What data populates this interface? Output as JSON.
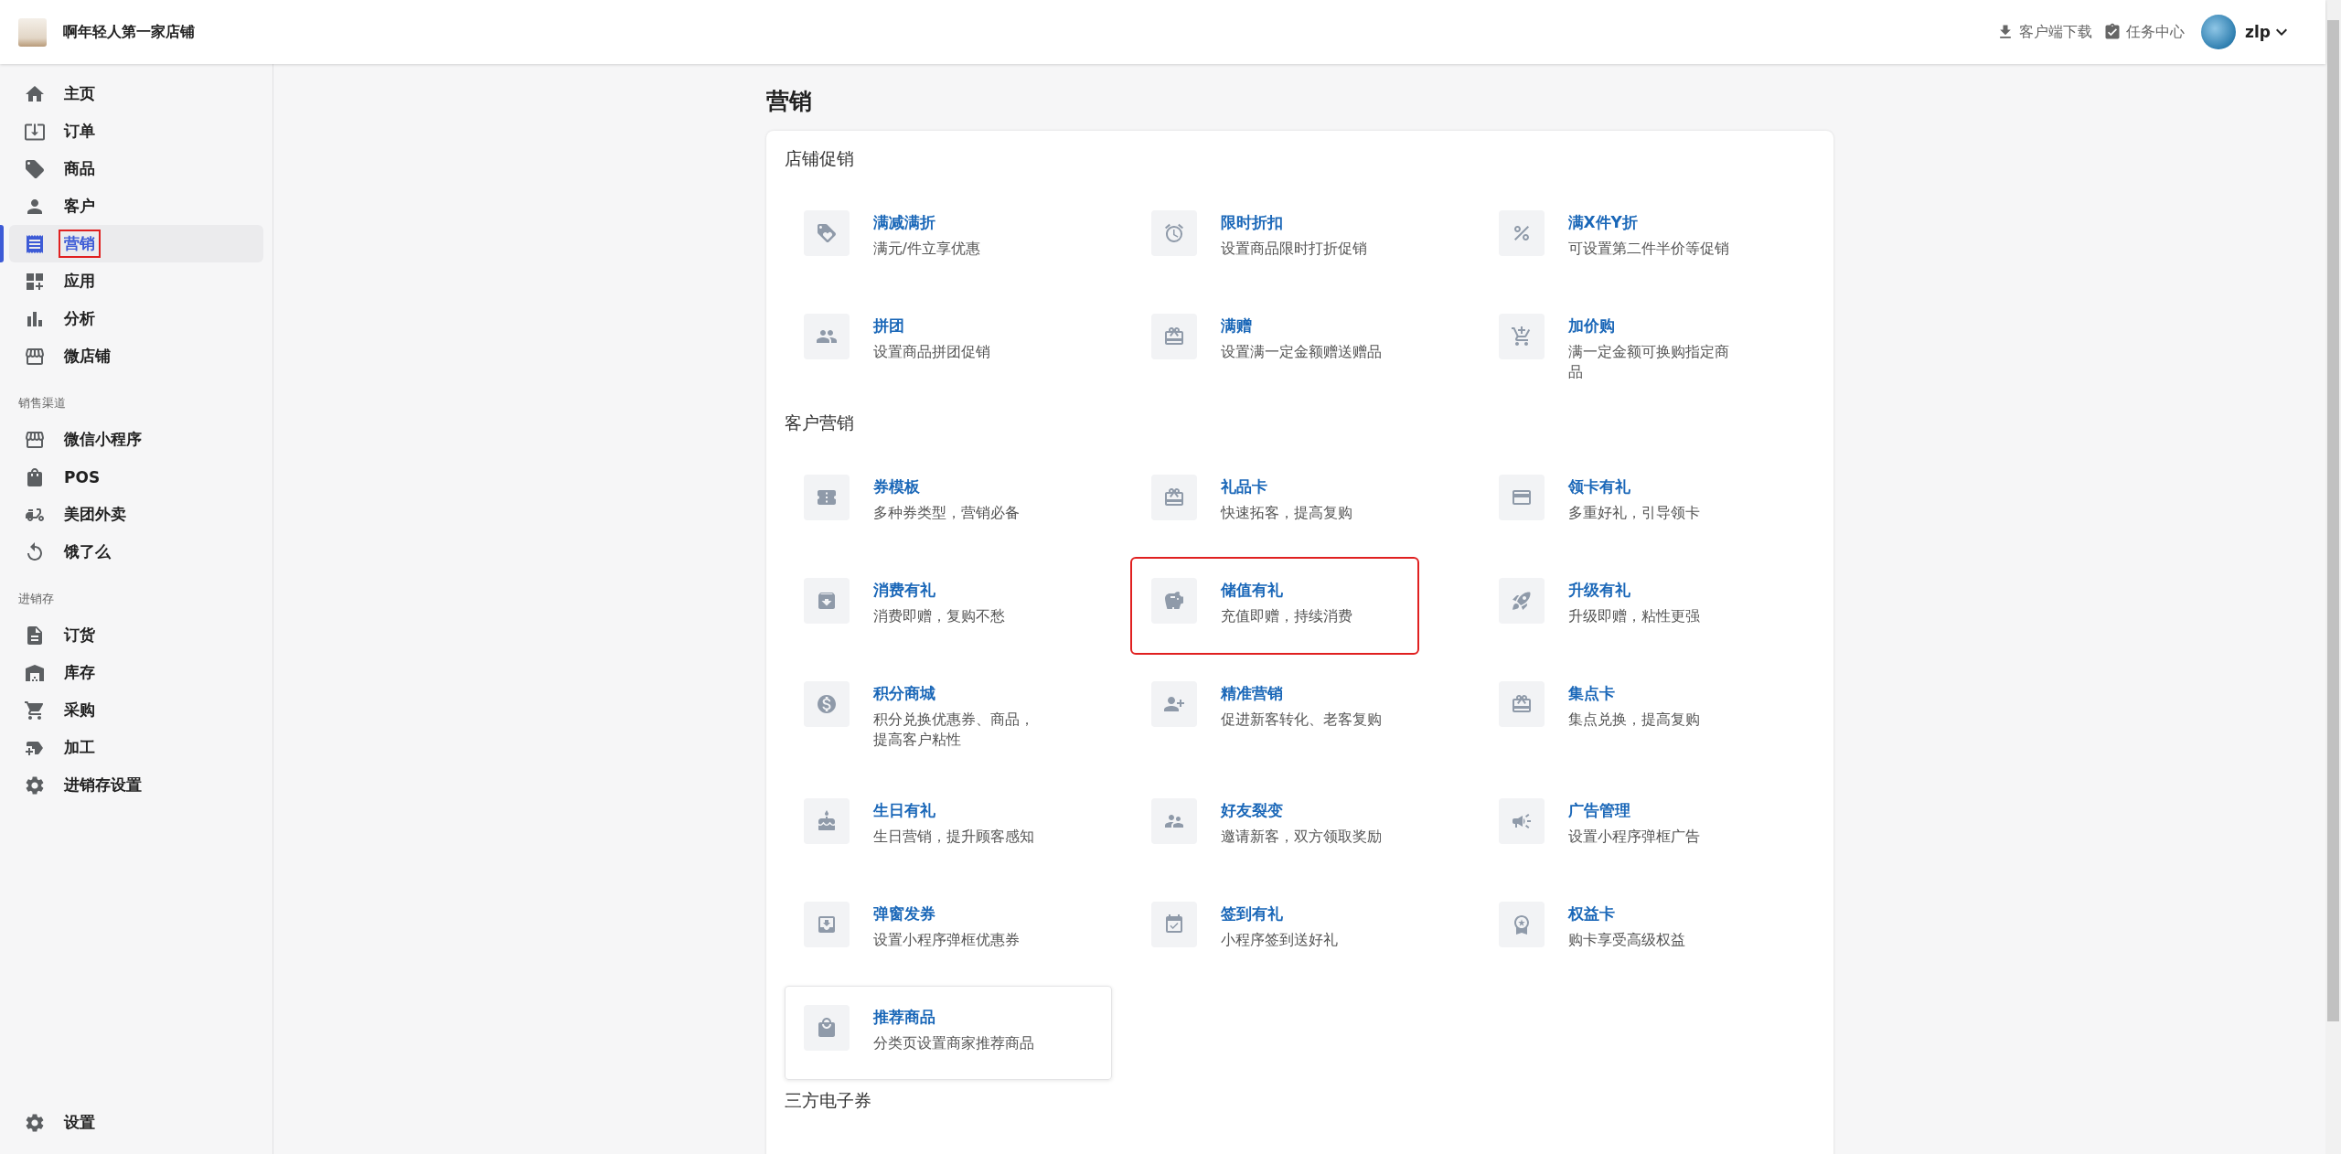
{
  "store": {
    "name": "啊年轻人第一家店铺"
  },
  "header": {
    "actions": [
      {
        "kind": "download",
        "label": "客户端下载"
      },
      {
        "kind": "tasks",
        "label": "任务中心"
      }
    ],
    "user": {
      "name": "zlp"
    }
  },
  "sidebar": {
    "groups": [
      {
        "items": [
          {
            "kind": "home",
            "label": "主页",
            "selected": false,
            "highlighted": false
          },
          {
            "kind": "orders",
            "label": "订单",
            "selected": false,
            "highlighted": false
          },
          {
            "kind": "tag",
            "label": "商品",
            "selected": false,
            "highlighted": false
          },
          {
            "kind": "person",
            "label": "客户",
            "selected": false,
            "highlighted": false
          },
          {
            "kind": "receipt",
            "label": "营销",
            "selected": true,
            "highlighted": true
          },
          {
            "kind": "apps",
            "label": "应用",
            "selected": false,
            "highlighted": false
          },
          {
            "kind": "chart",
            "label": "分析",
            "selected": false,
            "highlighted": false
          },
          {
            "kind": "store",
            "label": "微店铺",
            "selected": false,
            "highlighted": false
          }
        ]
      },
      {
        "heading": "销售渠道",
        "items": [
          {
            "kind": "store",
            "label": "微信小程序",
            "selected": false,
            "highlighted": false
          },
          {
            "kind": "bag",
            "label": "POS",
            "selected": false,
            "highlighted": false
          },
          {
            "kind": "delivery",
            "label": "美团外卖",
            "selected": false,
            "highlighted": false
          },
          {
            "kind": "eleme",
            "label": "饿了么",
            "selected": false,
            "highlighted": false
          }
        ]
      },
      {
        "heading": "进销存",
        "items": [
          {
            "kind": "doc",
            "label": "订货",
            "selected": false,
            "highlighted": false
          },
          {
            "kind": "warehouse",
            "label": "库存",
            "selected": false,
            "highlighted": false
          },
          {
            "kind": "cart",
            "label": "采购",
            "selected": false,
            "highlighted": false
          },
          {
            "kind": "newtag",
            "label": "加工",
            "selected": false,
            "highlighted": false
          },
          {
            "kind": "gear",
            "label": "进销存设置",
            "selected": false,
            "highlighted": false
          }
        ]
      }
    ],
    "footer": [
      {
        "kind": "gear",
        "label": "设置",
        "selected": false,
        "highlighted": false
      }
    ]
  },
  "page": {
    "title": "营销",
    "sections": [
      {
        "heading": "店铺促销",
        "tiles": [
          {
            "kind": "tags",
            "title": "满减满折",
            "description": "满元/件立享优惠",
            "highlighted": false,
            "hovered": false
          },
          {
            "kind": "timer",
            "title": "限时折扣",
            "description": "设置商品限时打折促销",
            "highlighted": false,
            "hovered": false
          },
          {
            "kind": "percent",
            "title": "满X件Y折",
            "description": "可设置第二件半价等促销",
            "highlighted": false,
            "hovered": false
          },
          {
            "kind": "people",
            "title": "拼团",
            "description": "设置商品拼团促销",
            "highlighted": false,
            "hovered": false
          },
          {
            "kind": "giftbadge",
            "title": "满赠",
            "description": "设置满一定金额赠送赠品",
            "highlighted": false,
            "hovered": false
          },
          {
            "kind": "cart",
            "title": "加价购",
            "description": "满一定金额可换购指定商品",
            "highlighted": false,
            "hovered": false
          }
        ]
      },
      {
        "heading": "客户营销",
        "tiles": [
          {
            "kind": "ticket",
            "title": "券模板",
            "description": "多种券类型，营销必备",
            "highlighted": false,
            "hovered": false
          },
          {
            "kind": "giftcard",
            "title": "礼品卡",
            "description": "快速拓客，提高复购",
            "highlighted": false,
            "hovered": false
          },
          {
            "kind": "card",
            "title": "领卡有礼",
            "description": "多重好礼，引导领卡",
            "highlighted": false,
            "hovered": false
          },
          {
            "kind": "archive",
            "title": "消费有礼",
            "description": "消费即赠，复购不愁",
            "highlighted": false,
            "hovered": false
          },
          {
            "kind": "moneybag",
            "title": "储值有礼",
            "description": "充值即赠，持续消费",
            "highlighted": true,
            "hovered": false
          },
          {
            "kind": "rocket",
            "title": "升级有礼",
            "description": "升级即赠，粘性更强",
            "highlighted": false,
            "hovered": false
          },
          {
            "kind": "coin",
            "title": "积分商城",
            "description": "积分兑换优惠券、商品，提高客户粘性",
            "highlighted": false,
            "hovered": false
          },
          {
            "kind": "personadd",
            "title": "精准营销",
            "description": "促进新客转化、老客复购",
            "highlighted": false,
            "hovered": false
          },
          {
            "kind": "gift",
            "title": "集点卡",
            "description": "集点兑换，提高复购",
            "highlighted": false,
            "hovered": false
          },
          {
            "kind": "cake",
            "title": "生日有礼",
            "description": "生日营销，提升顾客感知",
            "highlighted": false,
            "hovered": false
          },
          {
            "kind": "friends",
            "title": "好友裂变",
            "description": "邀请新客，双方领取奖励",
            "highlighted": false,
            "hovered": false
          },
          {
            "kind": "ad",
            "title": "广告管理",
            "description": "设置小程序弹框广告",
            "highlighted": false,
            "hovered": false
          },
          {
            "kind": "inbox",
            "title": "弹窗发券",
            "description": "设置小程序弹框优惠券",
            "highlighted": false,
            "hovered": false
          },
          {
            "kind": "calendar",
            "title": "签到有礼",
            "description": "小程序签到送好礼",
            "highlighted": false,
            "hovered": false
          },
          {
            "kind": "crown",
            "title": "权益卡",
            "description": "购卡享受高级权益",
            "highlighted": false,
            "hovered": false
          },
          {
            "kind": "shopbag",
            "title": "推荐商品",
            "description": "分类页设置商家推荐商品",
            "highlighted": false,
            "hovered": true
          }
        ]
      },
      {
        "heading": "三方电子券"
      }
    ]
  }
}
